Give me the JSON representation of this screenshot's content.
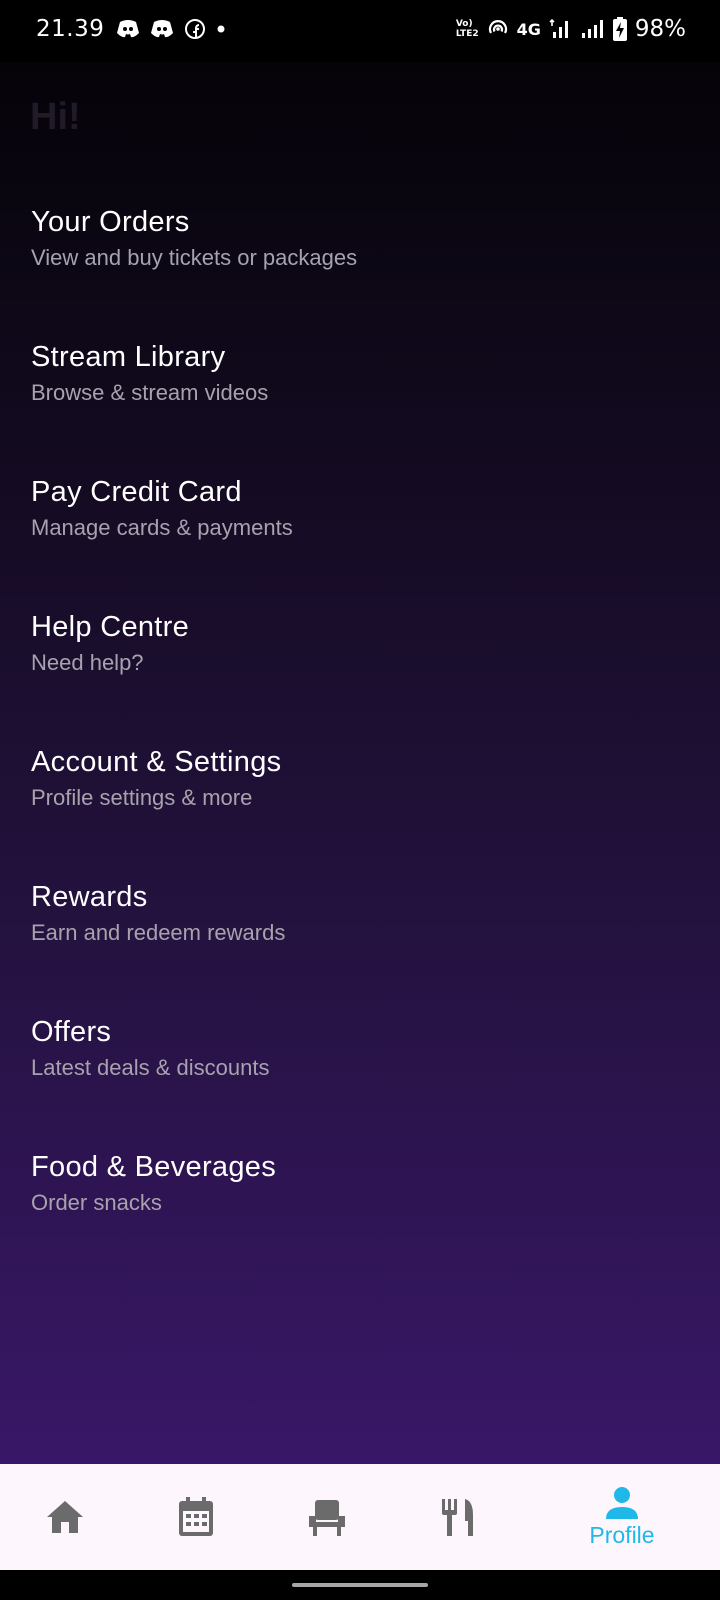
{
  "status_bar": {
    "time": "21.39",
    "volte_top": "Vo)",
    "volte_bottom": "LTE2",
    "network": "4G",
    "battery": "98%"
  },
  "greeting": "Hi!",
  "menu": [
    {
      "title": "Your Orders",
      "subtitle": "View and buy tickets or packages"
    },
    {
      "title": "Stream Library",
      "subtitle": "Browse & stream videos"
    },
    {
      "title": "Pay Credit Card",
      "subtitle": "Manage cards & payments"
    },
    {
      "title": "Help Centre",
      "subtitle": "Need help?"
    },
    {
      "title": "Account & Settings",
      "subtitle": "Profile settings & more"
    },
    {
      "title": "Rewards",
      "subtitle": "Earn and redeem rewards"
    },
    {
      "title": "Offers",
      "subtitle": "Latest deals & discounts"
    },
    {
      "title": "Food & Beverages",
      "subtitle": "Order snacks"
    }
  ],
  "bottom_nav": {
    "items": [
      {
        "icon": "home-icon"
      },
      {
        "icon": "calendar-icon"
      },
      {
        "icon": "seat-icon"
      },
      {
        "icon": "fork-knife-icon"
      },
      {
        "icon": "person-icon",
        "label": "Profile",
        "active": true
      }
    ]
  },
  "colors": {
    "active": "#1fb8e8",
    "inactive": "#6b6b6b",
    "nav_background": "#fdf7fd",
    "subtitle": "#a7a2ad"
  }
}
